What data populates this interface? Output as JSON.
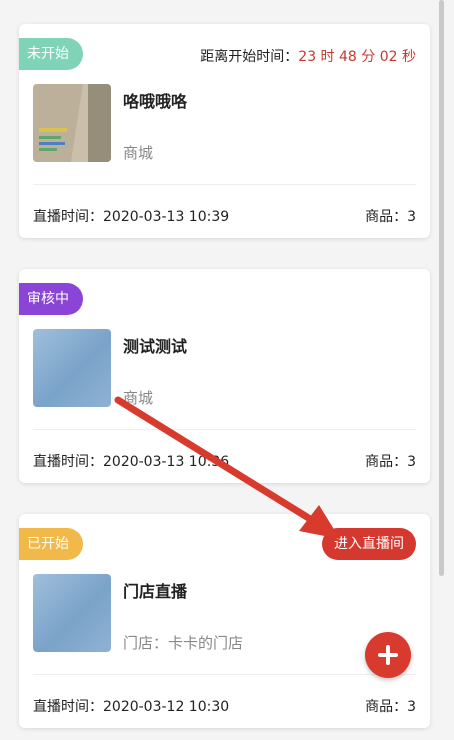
{
  "cards": [
    {
      "status": "未开始",
      "status_color": "#7fd4b8",
      "countdown_label": "距离开始时间：",
      "countdown_value": "23 时 48 分 02 秒",
      "title": "咯哦哦咯",
      "sub": "商城",
      "live_time": "直播时间：2020-03-13 10:39",
      "goods": "商品：3"
    },
    {
      "status": "审核中",
      "status_color": "#8a44d6",
      "title": "测试测试",
      "sub": "商城",
      "live_time": "直播时间：2020-03-13 10:36",
      "goods": "商品：3"
    },
    {
      "status": "已开始",
      "status_color": "#f0b949",
      "enter_label": "进入直播间",
      "title": "门店直播",
      "sub": "门店：卡卡的门店",
      "live_time": "直播时间：2020-03-12 10:30",
      "goods": "商品：3"
    }
  ],
  "colors": {
    "accent_red": "#d5382e",
    "countdown_red": "#c53a2e"
  },
  "icons": {
    "fab": "plus-icon",
    "annotation": "red-arrow"
  }
}
